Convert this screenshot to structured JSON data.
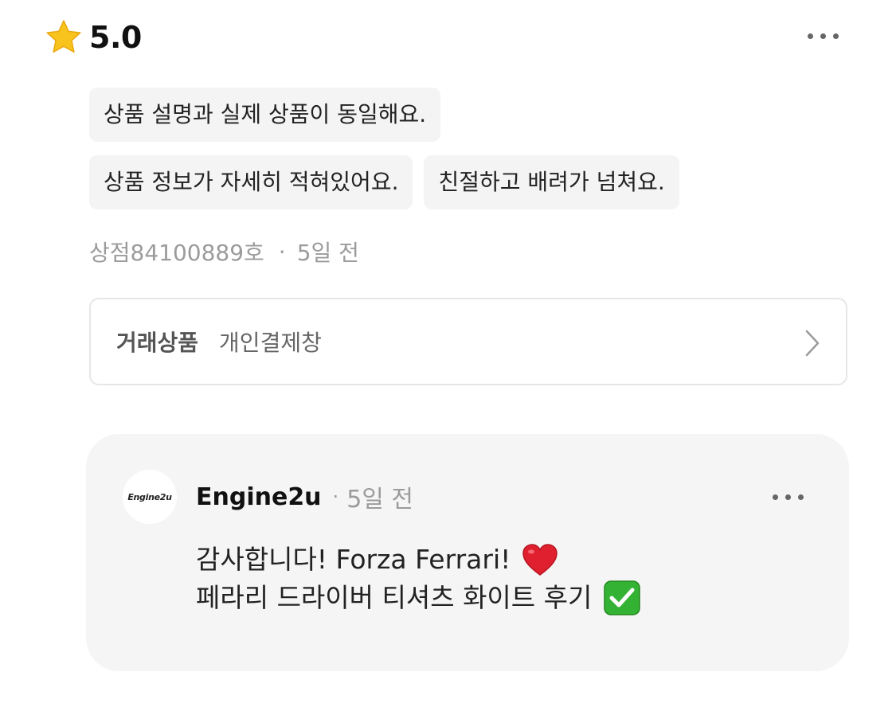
{
  "review": {
    "rating": "5.0",
    "tags": [
      [
        "상품 설명과 실제 상품이 동일해요."
      ],
      [
        "상품 정보가 자세히 적혀있어요.",
        "친절하고 배려가 넘쳐요."
      ]
    ],
    "reviewer": "상점84100889호",
    "time": "5일 전",
    "separator": "·"
  },
  "product": {
    "label": "거래상품",
    "name": "개인결제창"
  },
  "reply": {
    "seller_name": "Engine2u",
    "separator": "·",
    "time": "5일 전",
    "logo_text": "Engine2u",
    "lines": [
      "감사합니다! Forza Ferrari!",
      "페라리 드라이버 티셔츠 화이트 후기"
    ]
  },
  "icons": {
    "star": "star-icon",
    "more": "more-horizontal-icon",
    "chevron": "chevron-right-icon",
    "heart": "red-heart-emoji",
    "check": "check-mark-button-emoji"
  },
  "colors": {
    "star": "#F7C31C",
    "heart": "#E0202F",
    "check": "#34B233",
    "muted_text": "#9B9B9B",
    "tag_bg": "#F4F4F4",
    "reply_bg": "#F5F5F5"
  }
}
